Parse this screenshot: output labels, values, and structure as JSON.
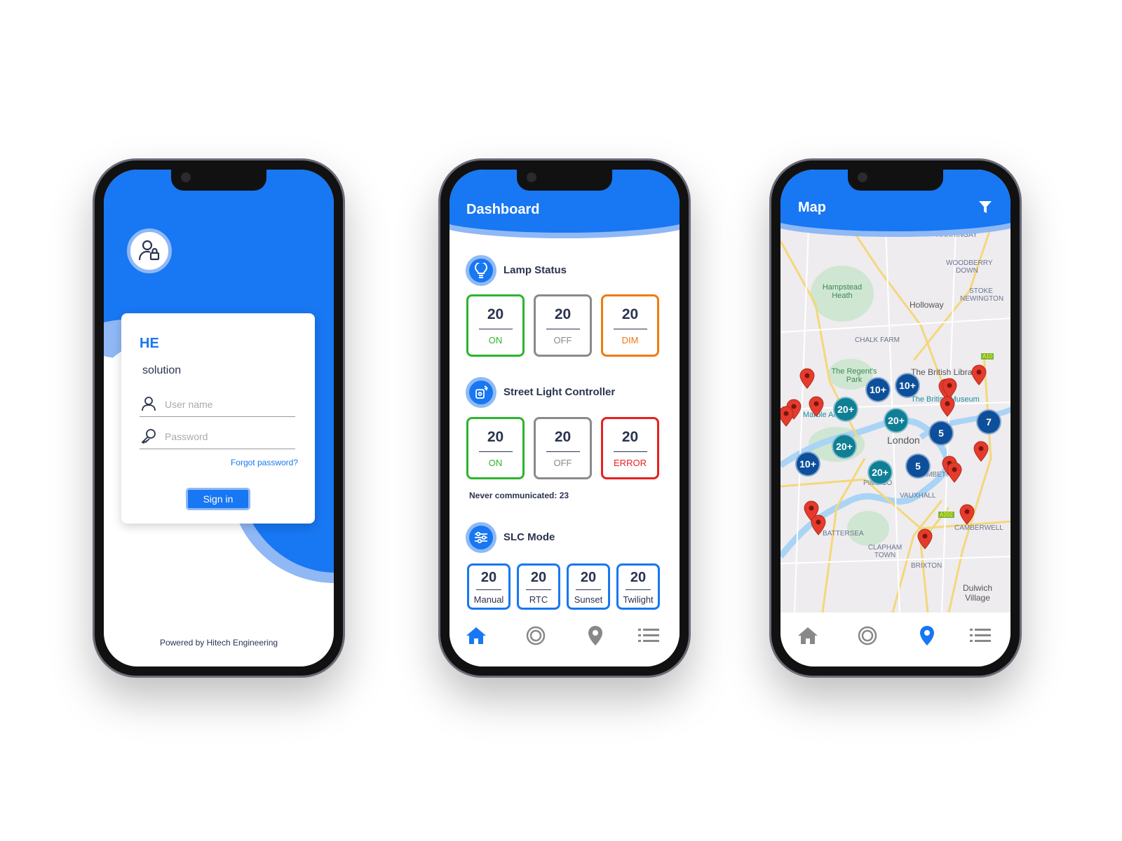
{
  "colors": {
    "primary": "#1877f2",
    "on": "#2db52d",
    "off": "#8a8a8a",
    "dim": "#f07a10",
    "error": "#e82020",
    "cluster_dark": "#0d4f9a",
    "cluster_teal": "#0f7f96",
    "pin": "#e53b2c"
  },
  "login": {
    "avatar_icon": "user-lock-icon",
    "brand": "HE",
    "subtitle": "solution",
    "username_placeholder": "User name",
    "password_placeholder": "Password",
    "forgot": "Forgot password?",
    "signin": "Sign in",
    "footer": "Powered by Hitech Engineering"
  },
  "dashboard": {
    "title": "Dashboard",
    "lamp": {
      "title": "Lamp Status",
      "items": [
        {
          "value": "20",
          "label": "ON"
        },
        {
          "value": "20",
          "label": "OFF"
        },
        {
          "value": "20",
          "label": "DIM"
        }
      ]
    },
    "slc": {
      "title": "Street Light Controller",
      "items": [
        {
          "value": "20",
          "label": "ON"
        },
        {
          "value": "20",
          "label": "OFF"
        },
        {
          "value": "20",
          "label": "ERROR"
        }
      ],
      "never": "Never communicated: 23"
    },
    "mode": {
      "title": "SLC Mode",
      "items": [
        {
          "value": "20",
          "label": "Manual"
        },
        {
          "value": "20",
          "label": "RTC"
        },
        {
          "value": "20",
          "label": "Sunset"
        },
        {
          "value": "20",
          "label": "Twilight"
        }
      ]
    }
  },
  "map": {
    "title": "Map",
    "labels": [
      "HARRINGAY",
      "WOODBERRY DOWN",
      "Hampstead Heath",
      "STOKE NEWINGTON",
      "Holloway",
      "CHALK FARM",
      "The Regent's Park",
      "The British Library",
      "The British Museum",
      "Marble Arch",
      "London",
      "LAMBETH",
      "PIMLICO",
      "VAUXHALL",
      "BATTERSEA",
      "CAMBERWELL",
      "CLAPHAM TOWN",
      "BRIXTON",
      "Dulwich Village",
      "A10",
      "A202"
    ],
    "clusters": [
      "10+",
      "10+",
      "20+",
      "20+",
      "5",
      "7",
      "20+",
      "10+",
      "20+",
      "5"
    ]
  },
  "nav": [
    "home-icon",
    "pulse-icon",
    "location-pin-icon",
    "menu-icon"
  ]
}
